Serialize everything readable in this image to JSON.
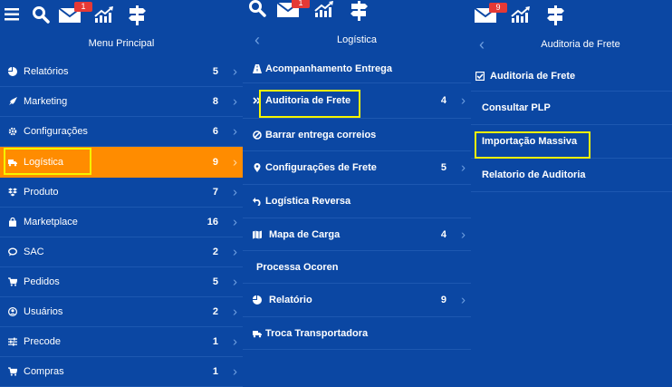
{
  "panel1": {
    "badge": "1",
    "title": "Menu Principal",
    "items": [
      {
        "icon": "pie-chart-icon",
        "label": "Relatórios",
        "count": "5"
      },
      {
        "icon": "rocket-icon",
        "label": "Marketing",
        "count": "8"
      },
      {
        "icon": "gear-icon",
        "label": "Configurações",
        "count": "6"
      },
      {
        "icon": "truck-icon",
        "label": "Logística",
        "count": "9"
      },
      {
        "icon": "dropbox-icon",
        "label": "Produto",
        "count": "7"
      },
      {
        "icon": "shopping-bag-icon",
        "label": "Marketplace",
        "count": "16"
      },
      {
        "icon": "chat-icon",
        "label": "SAC",
        "count": "2"
      },
      {
        "icon": "cart-icon",
        "label": "Pedidos",
        "count": "5"
      },
      {
        "icon": "user-circle-icon",
        "label": "Usuários",
        "count": "2"
      },
      {
        "icon": "sliders-icon",
        "label": "Precode",
        "count": "1"
      },
      {
        "icon": "cart-icon",
        "label": "Compras",
        "count": "1"
      }
    ]
  },
  "panel2": {
    "badge": "1",
    "title": "Logística",
    "items": [
      {
        "icon": "road-icon",
        "label": "Acompanhamento Entrega",
        "count": ""
      },
      {
        "icon": "double-chevron-icon",
        "label": "Auditoria de Frete",
        "count": "4"
      },
      {
        "icon": "ban-icon",
        "label": "Barrar entrega correios",
        "count": ""
      },
      {
        "icon": "map-marker-icon",
        "label": "Configurações de Frete",
        "count": "5"
      },
      {
        "icon": "undo-icon",
        "label": "Logística Reversa",
        "count": ""
      },
      {
        "icon": "map-icon",
        "label": "Mapa de Carga",
        "count": "4"
      },
      {
        "icon": "",
        "label": "Processa Ocoren",
        "count": ""
      },
      {
        "icon": "pie-chart-icon",
        "label": "Relatório",
        "count": "9"
      },
      {
        "icon": "truck-icon",
        "label": "Troca Transportadora",
        "count": ""
      }
    ]
  },
  "panel3": {
    "badge": "9",
    "title": "Auditoria de Frete",
    "items": [
      {
        "icon": "checkbox-icon",
        "label": "Auditoria de Frete"
      },
      {
        "icon": "",
        "label": "Consultar PLP"
      },
      {
        "icon": "",
        "label": "Importação Massiva"
      },
      {
        "icon": "",
        "label": "Relatorio de Auditoria"
      }
    ]
  },
  "colors": {
    "background": "#0b47a3",
    "active": "#ff8c00",
    "highlight": "#f5f500",
    "badge": "#e53935"
  }
}
